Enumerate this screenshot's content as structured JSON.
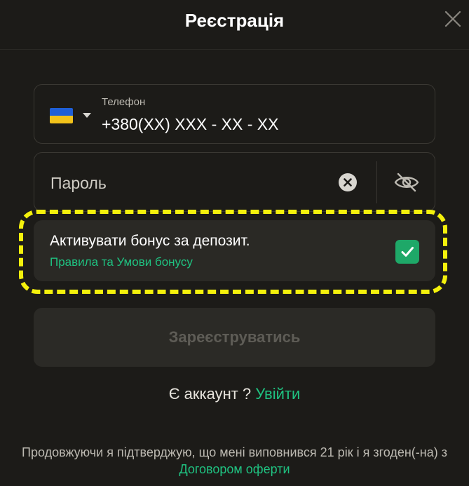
{
  "header": {
    "title": "Реєстрація"
  },
  "phone": {
    "label": "Телефон",
    "value": "+380(XX) XXX - XX - XX",
    "country_flag": "ukraine-flag",
    "flag_colors": {
      "top": "#1f5fd6",
      "bottom": "#f2c21a"
    }
  },
  "password": {
    "placeholder": "Пароль"
  },
  "bonus": {
    "label": "Активувати бонус за депозит.",
    "link": "Правила та Умови бонусу",
    "checked": true
  },
  "submit": {
    "label": "Зареєструватись"
  },
  "login": {
    "prompt": "Є аккаунт ?",
    "link": "Увійти"
  },
  "terms": {
    "text": "Продовжуючи я підтверджую, що мені виповнився 21 рік і я згоден(-на) з",
    "link": "Договором оферти"
  },
  "colors": {
    "background": "#1c1b18",
    "accent": "#1fc281",
    "checkbox": "#1ea868",
    "highlight": "#f4f10c"
  }
}
